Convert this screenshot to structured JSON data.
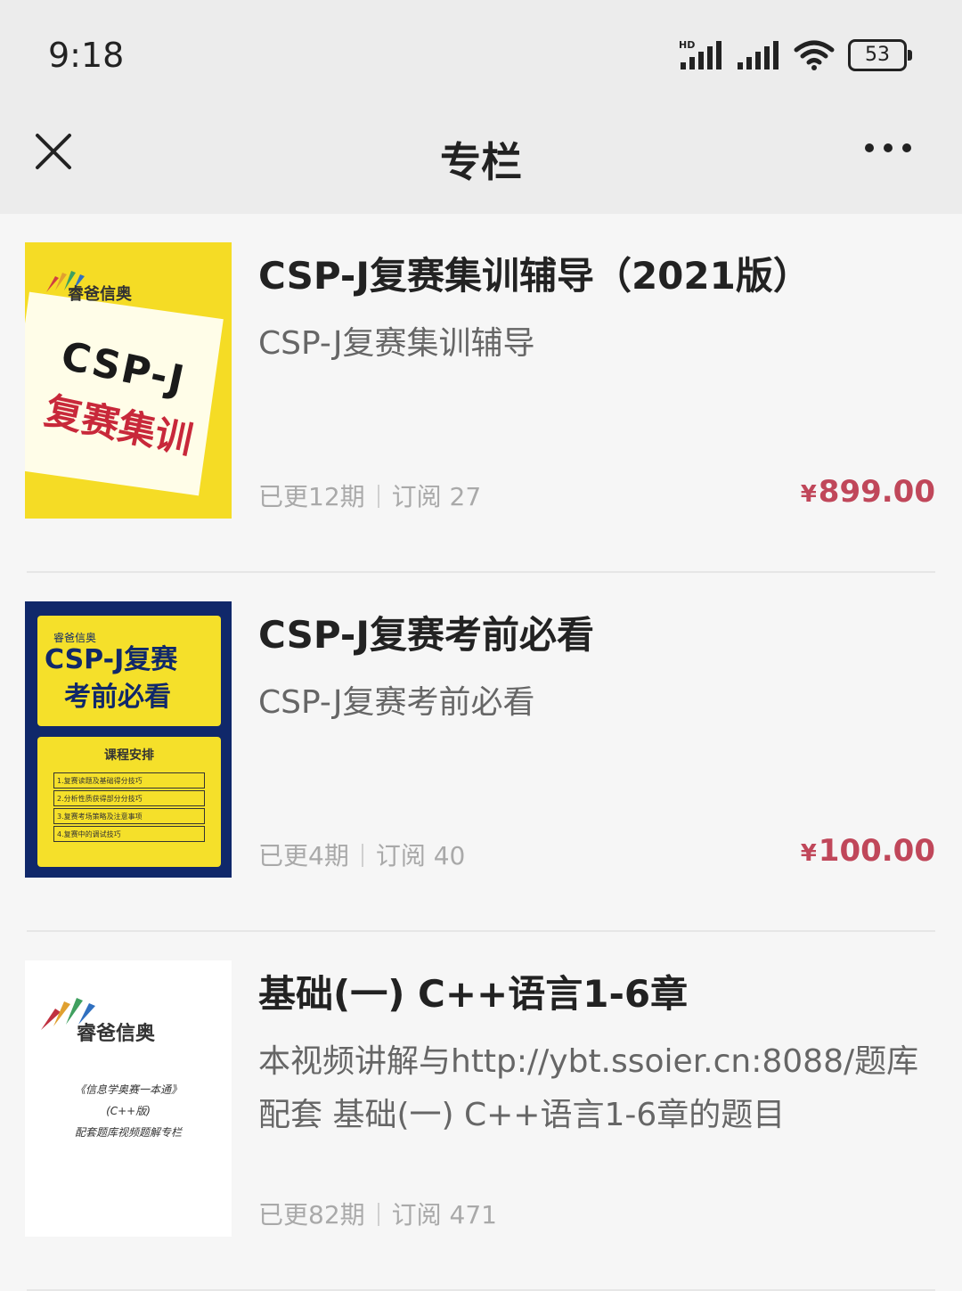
{
  "status_bar": {
    "time": "9:18",
    "battery": "53",
    "icons": [
      "signal-hd-icon",
      "signal-icon",
      "wifi-icon",
      "battery-icon"
    ]
  },
  "nav": {
    "title": "专栏",
    "icons": [
      "close-icon",
      "more-icon"
    ]
  },
  "items": [
    {
      "title": "CSP-J复赛集训辅导（2021版）",
      "description": "CSP-J复赛集训辅导",
      "updates": "已更12期",
      "subscriptions": "订阅 27",
      "price": "899.00",
      "currency": "¥",
      "cover": {
        "brand": "睿爸信奥",
        "line1": "CSP-J",
        "line2": "复赛集训"
      }
    },
    {
      "title": "CSP-J复赛考前必看",
      "description": "CSP-J复赛考前必看",
      "updates": "已更4期",
      "subscriptions": "订阅 40",
      "price": "100.00",
      "currency": "¥",
      "cover": {
        "brand": "睿爸信奥",
        "line1": "CSP-J复赛",
        "line2": "考前必看",
        "schedule_title": "课程安排",
        "schedule": [
          "1.复赛读题及基础得分技巧",
          "2.分析性质获得部分分技巧",
          "3.复赛考场策略及注意事项",
          "4.复赛中的调试技巧"
        ]
      }
    },
    {
      "title": "基础(一) C++语言1-6章",
      "description": "本视频讲解与http://ybt.ssoier.cn:8088/题库配套 基础(一) C++语言1-6章的题目",
      "updates": "已更82期",
      "subscriptions": "订阅 471",
      "cover": {
        "brand": "睿爸信奥",
        "line1": "《信息学奥赛一本通》",
        "line2": "(C++版)",
        "line3": "配套题库视频题解专栏"
      }
    }
  ],
  "colors": {
    "price": "#c0475a",
    "header_bg": "#ececec",
    "page_bg": "#f6f6f6",
    "cover_yellow": "#f5dc25",
    "cover_navy": "#10286a"
  }
}
